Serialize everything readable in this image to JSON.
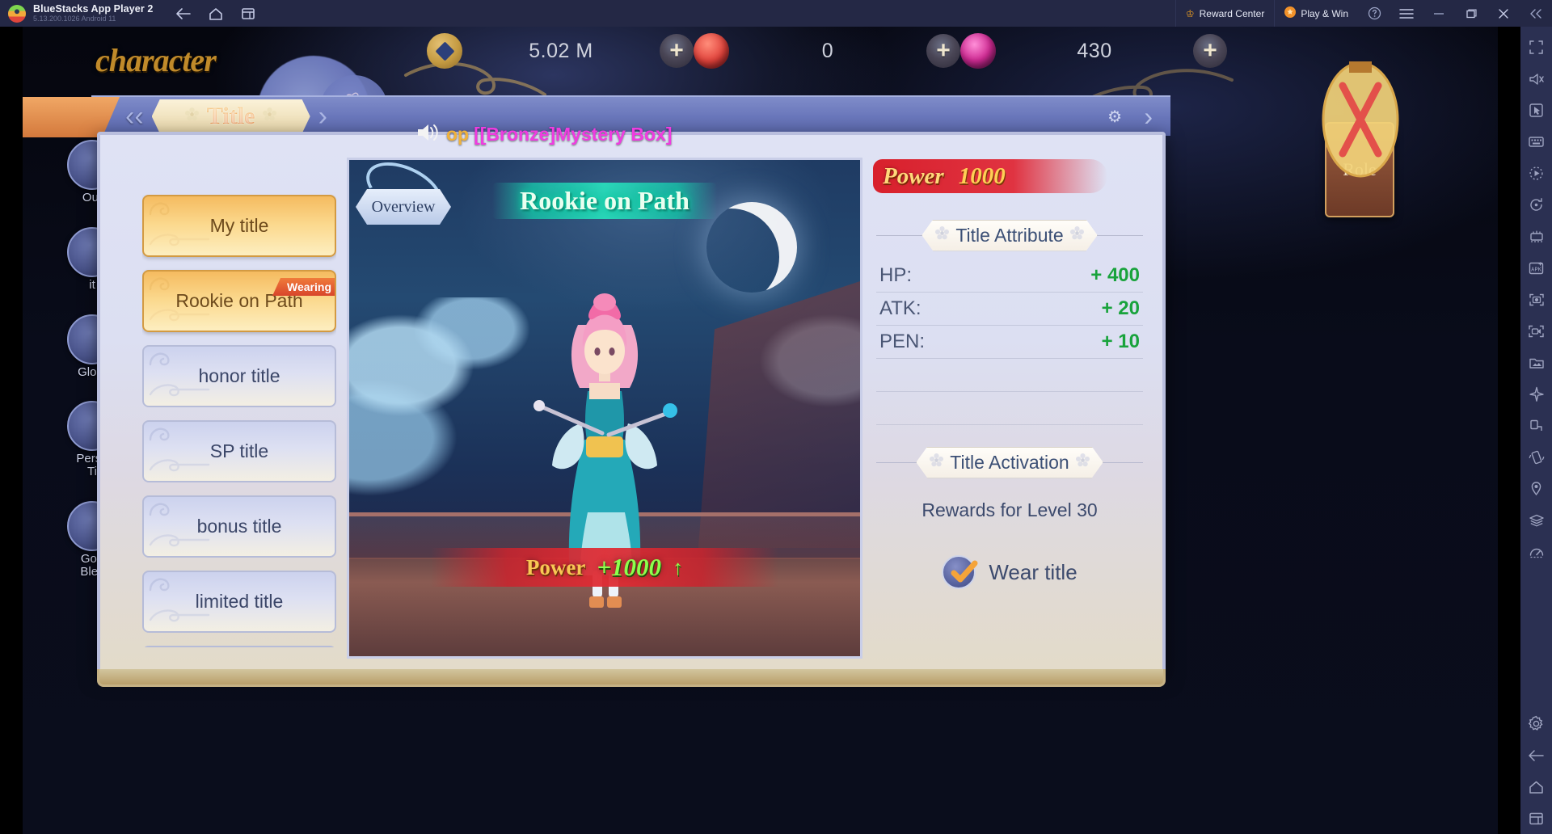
{
  "window": {
    "app_title": "BlueStacks App Player 2",
    "version_line": "5.13.200.1026  Android 11",
    "nav": {
      "back": "back-arrow",
      "home": "home",
      "recents": "recent-apps"
    },
    "reward_center": "Reward Center",
    "play_and_win": "Play & Win",
    "controls": [
      "help",
      "menu",
      "minimize",
      "maximize",
      "close",
      "collapse"
    ]
  },
  "right_toolbar": {
    "items": [
      "fullscreen-icon",
      "mute-icon",
      "pointer-icon",
      "keyboard-icon",
      "macro-record-icon",
      "sync-icon",
      "multi-instance-icon",
      "install-apk-icon",
      "screenshot-icon",
      "record-video-icon",
      "media-manager-icon",
      "airplane-icon",
      "rotate-icon",
      "shake-icon",
      "location-icon",
      "layers-icon",
      "meter-icon",
      "settings-icon",
      "back-icon",
      "home-icon",
      "recents-icon"
    ]
  },
  "game": {
    "background_word": "character",
    "header": {
      "title": "Title",
      "left_chevron": "double-left-chevron",
      "right_chevron": "right-chevron",
      "gear": "gear-icon"
    },
    "currencies": [
      {
        "icon": "gold-coin-icon",
        "value": "5.02 M",
        "plus": "+"
      },
      {
        "icon": "red-gem-icon",
        "value": "0",
        "plus": "+"
      },
      {
        "icon": "purple-gem-icon",
        "value": "430",
        "plus": "+"
      }
    ],
    "left_nav": [
      {
        "label": "Out"
      },
      {
        "label": "it"
      },
      {
        "label": "Glory"
      },
      {
        "label": "Perso\nTi"
      },
      {
        "label": "God\nBles"
      }
    ],
    "role_button": "Role",
    "marquee": {
      "speaker": "speaker-icon",
      "text_a": "op",
      "text_b": "[[Bronze]Mystery Box]"
    },
    "title_list": [
      {
        "label": "My title",
        "state": "active",
        "badge": null
      },
      {
        "label": "Rookie on Path",
        "state": "active",
        "badge": "Wearing"
      },
      {
        "label": "honor title",
        "state": "plain",
        "badge": null
      },
      {
        "label": "SP title",
        "state": "plain",
        "badge": null
      },
      {
        "label": "bonus title",
        "state": "plain",
        "badge": null
      },
      {
        "label": "limited title",
        "state": "plain",
        "badge": null
      }
    ],
    "stage": {
      "overview_button": "Overview",
      "title_name": "Rookie on Path",
      "power_label": "Power",
      "power_delta": "+1000",
      "power_arrow": "↑"
    },
    "info": {
      "power_label": "Power",
      "power_value": "1000",
      "attribute_header": "Title Attribute",
      "stats": [
        {
          "key": "HP:",
          "value": "+ 400"
        },
        {
          "key": "ATK:",
          "value": "+ 20"
        },
        {
          "key": "PEN:",
          "value": "+ 10"
        }
      ],
      "activation_header": "Title Activation",
      "reward_text": "Rewards for Level 30",
      "wear_label": "Wear title",
      "wear_checked": true
    }
  },
  "colors": {
    "titlebar_bg": "#242845",
    "toolbar_bg": "#2b3052",
    "accent_orange": "#f0a020",
    "stat_green": "#19a33c",
    "power_red": "#e03341",
    "banner_gold": "#f6c35c"
  }
}
